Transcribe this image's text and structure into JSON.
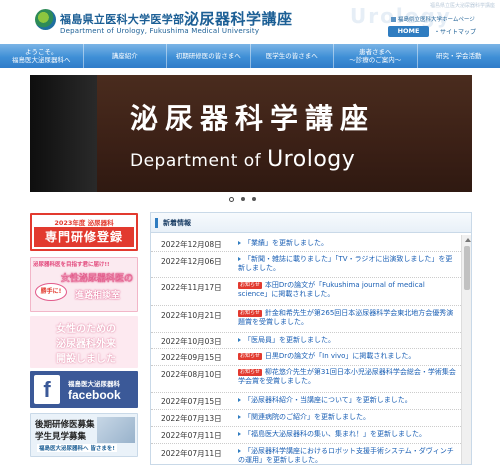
{
  "header": {
    "org_name": "福島県立医科大学医学部",
    "dept_name": "泌尿器科学講座",
    "org_en": "Department of Urology, Fukushima Medical University",
    "watermark": "Urology",
    "watermark_small": "福島県立医大泌尿器科学講座",
    "univ_link": "福島県立医科大学ホームページ",
    "home_label": "HOME",
    "sitemap_label": "・サイトマップ"
  },
  "nav": {
    "items": [
      {
        "line1": "ようこそ。",
        "line2": "福島医大泌尿器科へ"
      },
      {
        "line1": "講座紹介",
        "line2": ""
      },
      {
        "line1": "初期研修医の皆さまへ",
        "line2": ""
      },
      {
        "line1": "医学生の皆さまへ",
        "line2": ""
      },
      {
        "line1": "患者さまへ",
        "line2": "〜診療のご案内〜"
      },
      {
        "line1": "研究・学会活動",
        "line2": ""
      }
    ]
  },
  "hero": {
    "sign_jp": "泌尿器科学講座",
    "sign_en_prefix": "Department of ",
    "sign_en_main": "Urology",
    "slide_count": 3,
    "active_slide": 1
  },
  "sidebar": {
    "training": {
      "year": "2023年度 泌尿器科",
      "title": "専門研修登録"
    },
    "consult": {
      "top": "泌尿器科医を目指す君に届け!!",
      "line1": "女性泌尿器科医の",
      "bubble": "勝手に!",
      "line2": "進路相談室"
    },
    "clinic": {
      "line1": "女性のための",
      "line2": "泌尿器科外来",
      "line3": "開設しました"
    },
    "facebook": {
      "letter": "f",
      "sub": "福島医大泌尿器科",
      "name": "facebook"
    },
    "recruit": {
      "line1": "後期研修医募集",
      "line2": "学生見学募集",
      "line3": "福島医大泌尿器科へ 皆さまを!"
    }
  },
  "news": {
    "heading": "新着情報",
    "badge_label": "お知らせ",
    "items": [
      {
        "date": "2022年12月08日",
        "text": "「業績」を更新しました。",
        "badge": false
      },
      {
        "date": "2022年12月06日",
        "text": "「新聞・雑誌に載りました」「TV・ラジオに出演致しました」を更新しました。",
        "badge": false
      },
      {
        "date": "2022年11月17日",
        "text": "本田Drの論文が「Fukushima journal of medical science」に掲載されました。",
        "badge": true
      },
      {
        "date": "2022年10月21日",
        "text": "針金和希先生が第265回日本泌尿器科学会東北地方会優秀演題賞を受賞しました。",
        "badge": true
      },
      {
        "date": "2022年10月03日",
        "text": "「医局員」を更新しました。",
        "badge": false
      },
      {
        "date": "2022年09月15日",
        "text": "日黒Drの論文が「In vivo」に掲載されました。",
        "badge": true
      },
      {
        "date": "2022年08月10日",
        "text": "柳花悠介先生が第31回日本小児泌尿器科学会総会・学術集会 学会賞を受賞しました。",
        "badge": true
      },
      {
        "date": "2022年07月15日",
        "text": "「泌尿器科紹介・当講座について」を更新しました。",
        "badge": false
      },
      {
        "date": "2022年07月13日",
        "text": "「関連病院のご紹介」を更新しました。",
        "badge": false
      },
      {
        "date": "2022年07月11日",
        "text": "「福島医大泌尿器科の集い、集まれ！」を更新しました。",
        "badge": false
      },
      {
        "date": "2022年07月11日",
        "text": "「泌尿器科学講座におけるロボット支援手術システム・ダヴィンチの運用」を更新しました。",
        "badge": false
      }
    ]
  }
}
